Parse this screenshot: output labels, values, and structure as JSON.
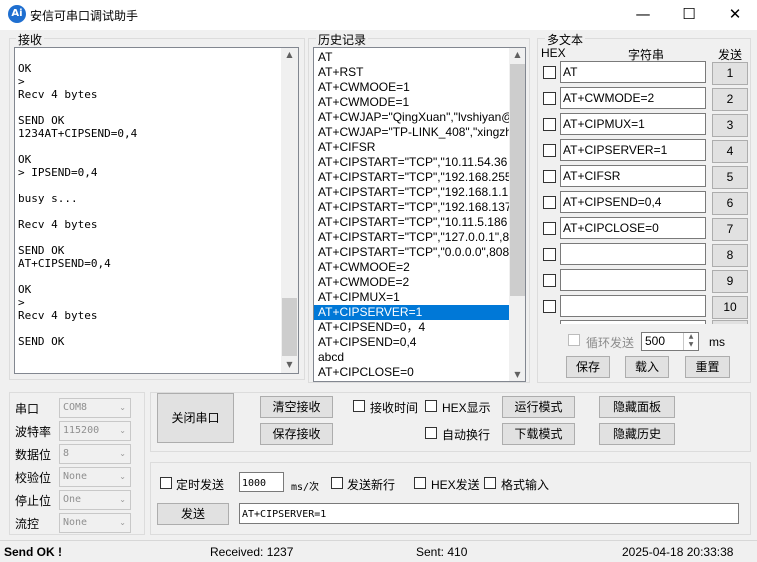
{
  "window": {
    "title": "安信可串口调试助手",
    "icon_text": "Ai",
    "min": "—",
    "max": "☐",
    "close": "✕"
  },
  "receive": {
    "label": "接收",
    "text": "OK\n>\nRecv 4 bytes\n\nSEND OK\n1234AT+CIPSEND=0,4\n\nOK\n> IPSEND=0,4\n\nbusy s...\n\nRecv 4 bytes\n\nSEND OK\nAT+CIPSEND=0,4\n\nOK\n>\nRecv 4 bytes\n\nSEND OK"
  },
  "history": {
    "label": "历史记录",
    "items": [
      "AT",
      "AT+RST",
      "AT+CWMOOE=1",
      "AT+CWMODE=1",
      "AT+CWJAP=\"QingXuan\",\"lvshiyan@",
      "AT+CWJAP=\"TP-LINK_408\",\"xingzh",
      "AT+CIFSR",
      "AT+CIPSTART=\"TCP\",\"10.11.54.36",
      "AT+CIPSTART=\"TCP\",\"192.168.255",
      "AT+CIPSTART=\"TCP\",\"192.168.1.1",
      "AT+CIPSTART=\"TCP\",\"192.168.137",
      "AT+CIPSTART=\"TCP\",\"10.11.5.186",
      "AT+CIPSTART=\"TCP\",\"127.0.0.1\",8",
      "AT+CIPSTART=\"TCP\",\"0.0.0.0\",808",
      "AT+CWMOOE=2",
      "AT+CWMODE=2",
      "AT+CIPMUX=1",
      "AT+CIPSERVER=1",
      "AT+CIPSEND=0，4",
      "AT+CIPSEND=0,4",
      "abcd",
      "AT+CIPCLOSE=0"
    ],
    "selected_index": 17
  },
  "multitext": {
    "label": "多文本",
    "hex_header": "HEX",
    "string_header": "字符串",
    "send_header": "发送",
    "rows": [
      {
        "text": "AT",
        "btn": "1"
      },
      {
        "text": "AT+CWMODE=2",
        "btn": "2"
      },
      {
        "text": "AT+CIPMUX=1",
        "btn": "3"
      },
      {
        "text": "AT+CIPSERVER=1",
        "btn": "4"
      },
      {
        "text": "AT+CIFSR",
        "btn": "5"
      },
      {
        "text": "AT+CIPSEND=0,4",
        "btn": "6"
      },
      {
        "text": "AT+CIPCLOSE=0",
        "btn": "7"
      },
      {
        "text": "",
        "btn": "8"
      },
      {
        "text": "",
        "btn": "9"
      },
      {
        "text": "",
        "btn": "10"
      }
    ],
    "loop_label": "循环发送",
    "loop_value": "500",
    "loop_unit": "ms",
    "save": "保存",
    "load": "载入",
    "reset": "重置"
  },
  "port": {
    "labels": [
      "串口",
      "波特率",
      "数据位",
      "校验位",
      "停止位",
      "流控"
    ],
    "values": [
      "COM8",
      "115200",
      "8",
      "None",
      "One",
      "None"
    ],
    "close_port": "关闭串口"
  },
  "actions": {
    "clear_recv": "清空接收",
    "save_recv": "保存接收",
    "recv_time": "接收时间",
    "hex_display": "HEX显示",
    "auto_wrap": "自动换行",
    "run_mode": "运行模式",
    "download_mode": "下载模式",
    "hide_panel": "隐藏面板",
    "hide_history": "隐藏历史"
  },
  "send": {
    "timed_send": "定时发送",
    "interval": "1000",
    "interval_unit": "ms/次",
    "newline": "发送新行",
    "hex_send": "HEX发送",
    "format_input": "格式输入",
    "send_btn": "发送",
    "input": "AT+CIPSERVER=1"
  },
  "status": {
    "msg": "Send OK !",
    "received": "Received: 1237",
    "sent": "Sent: 410",
    "datetime": "2025-04-18 20:33:38"
  }
}
